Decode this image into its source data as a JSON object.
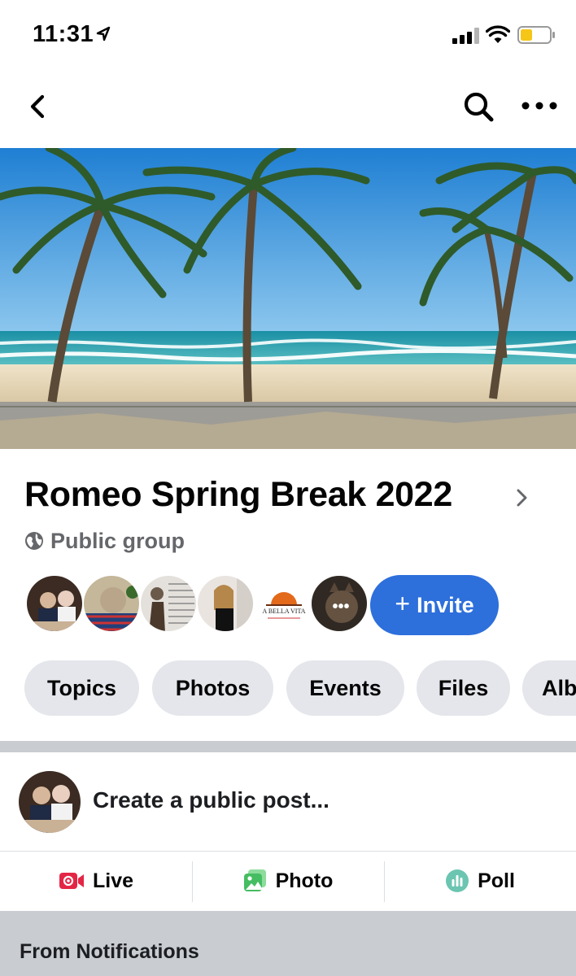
{
  "status_bar": {
    "time": "11:31"
  },
  "group": {
    "name": "Romeo Spring Break 2022",
    "privacy": "Public group"
  },
  "members": {
    "brand_avatar_text": "A BELLA VITA",
    "more_label": "•••"
  },
  "invite": {
    "plus": "+",
    "label": "Invite"
  },
  "tabs": [
    {
      "label": "Topics"
    },
    {
      "label": "Photos"
    },
    {
      "label": "Events"
    },
    {
      "label": "Files"
    },
    {
      "label": "Alb"
    }
  ],
  "composer": {
    "prompt": "Create a public post...",
    "actions": [
      {
        "label": "Live",
        "icon": "live-video-icon",
        "color": "#e42645"
      },
      {
        "label": "Photo",
        "icon": "photo-icon",
        "color": "#45bd62"
      },
      {
        "label": "Poll",
        "icon": "poll-icon",
        "color": "#6bc5b1"
      }
    ]
  },
  "section": {
    "title": "From Notifications"
  },
  "colors": {
    "accent": "#2d6fdb",
    "secondary_text": "#65676b",
    "chip_bg": "#e4e6eb"
  }
}
